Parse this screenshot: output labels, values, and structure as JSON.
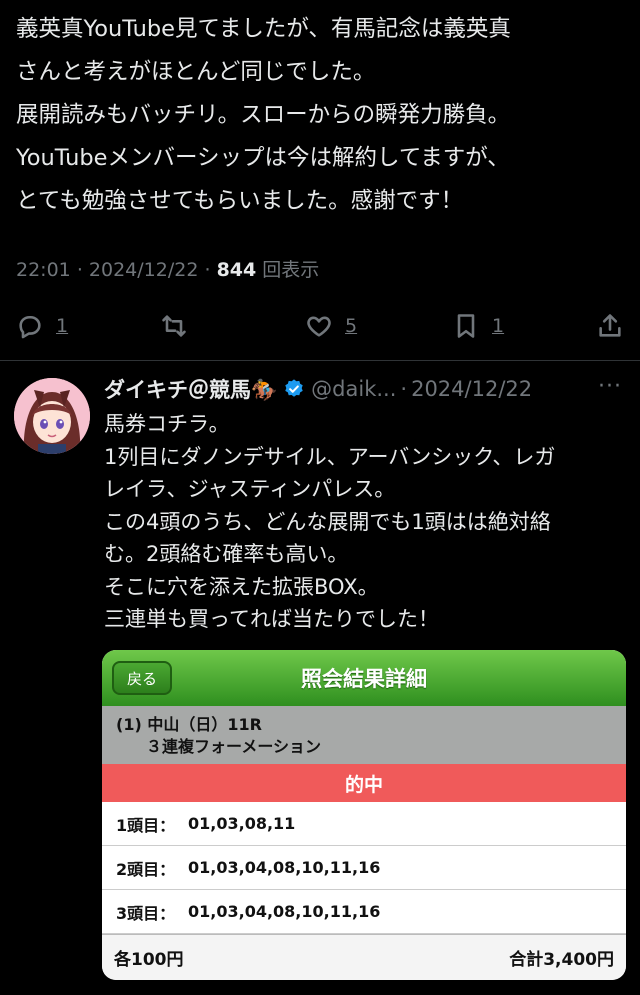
{
  "tweet": {
    "lines": [
      "義英真YouTube見てましたが、有馬記念は義英真",
      "さんと考えがほとんど同じでした。",
      "展開読みもバッチリ。スローからの瞬発力勝負。",
      "YouTubeメンバーシップは今は解約してますが、",
      "とても勉強させてもらいました。感謝です！"
    ],
    "time": "22:01",
    "date": "2024/12/22",
    "views": "844",
    "views_label": "回表示"
  },
  "actions": {
    "reply_count": "1",
    "retweet_count": "",
    "like_count": "5",
    "bookmark_count": "1"
  },
  "reply": {
    "name": "ダイキチ＠競馬🏇",
    "handle": "@daik...",
    "date": "2024/12/22",
    "lines": [
      "馬券コチラ。",
      "1列目にダノンデサイル、アーバンシック、レガ",
      "レイラ、ジャスティンパレス。",
      "この4頭のうち、どんな展開でも1頭はは絶対絡",
      "む。2頭絡む確率も高い。",
      "そこに穴を添えた拡張BOX。",
      "三連単も買ってれば当たりでした！"
    ]
  },
  "card": {
    "back_label": "戻る",
    "title": "照会結果詳細",
    "race_line": "(1) 中山（日）11R",
    "bet_type": "３連複フォーメーション",
    "hit_label": "的中",
    "rows": [
      {
        "label": "1頭目：",
        "value": "01,03,08,11"
      },
      {
        "label": "2頭目：",
        "value": "01,03,04,08,10,11,16"
      },
      {
        "label": "3頭目：",
        "value": "01,03,04,08,10,11,16"
      }
    ],
    "unit_price": "各100円",
    "total": "合計3,400円"
  },
  "colors": {
    "background": "#000000",
    "text": "#e7e9ea",
    "muted": "#71767b",
    "verified": "#1d9bf0",
    "card_header": "#3a9a28",
    "hit_bar": "#f05a5a"
  }
}
